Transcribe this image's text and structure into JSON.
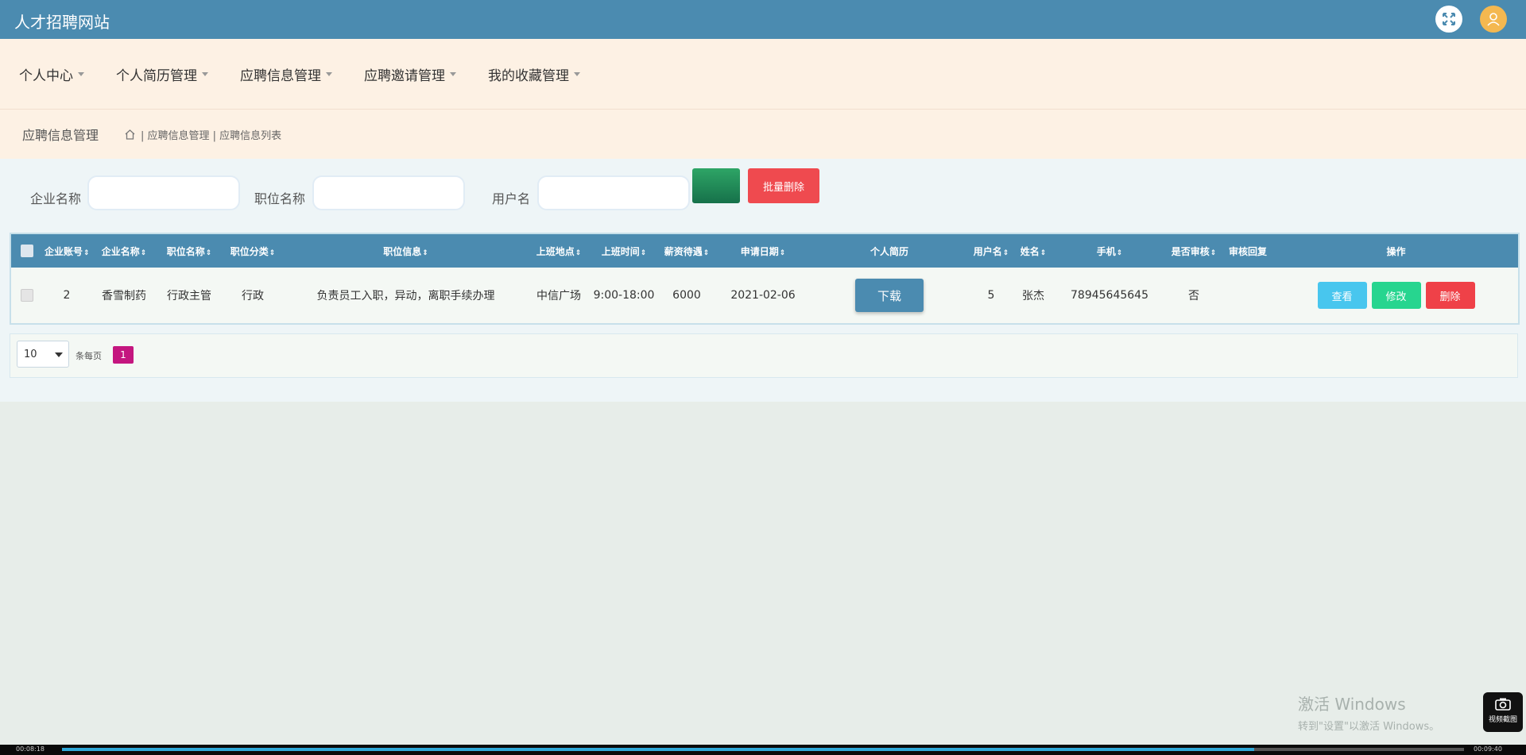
{
  "header": {
    "site_title": "人才招聘网站"
  },
  "nav": [
    {
      "label": "个人中心"
    },
    {
      "label": "个人简历管理"
    },
    {
      "label": "应聘信息管理"
    },
    {
      "label": "应聘邀请管理"
    },
    {
      "label": "我的收藏管理"
    }
  ],
  "breadcrumb": {
    "page_title": "应聘信息管理",
    "path": "| 应聘信息管理 | 应聘信息列表"
  },
  "search": {
    "company_label": "企业名称",
    "position_label": "职位名称",
    "username_label": "用户名",
    "search_button": "",
    "batch_delete_button": "批量删除"
  },
  "table": {
    "columns": [
      "企业账号",
      "企业名称",
      "职位名称",
      "职位分类",
      "职位信息",
      "上班地点",
      "上班时间",
      "薪资待遇",
      "申请日期",
      "个人简历",
      "用户名",
      "姓名",
      "手机",
      "是否审核",
      "审核回复",
      "操作"
    ],
    "rows": [
      {
        "company_account": "2",
        "company_name": "香雪制药",
        "position_name": "行政主管",
        "position_category": "行政",
        "position_info": "负责员工入职，异动，离职手续办理",
        "work_location": "中信广场",
        "work_hours": "9:00-18:00",
        "salary": "6000",
        "apply_date": "2021-02-06",
        "resume_button": "下载",
        "username": "5",
        "name": "张杰",
        "phone": "78945645645",
        "reviewed": "否",
        "review_reply": "",
        "view_button": "查看",
        "edit_button": "修改",
        "delete_button": "删除"
      }
    ]
  },
  "pagination": {
    "page_size": "10",
    "per_page_label": "条每页",
    "current_page": "1"
  },
  "watermark": {
    "title": "激活 Windows",
    "subtitle": "转到\"设置\"以激活 Windows。"
  },
  "video": {
    "current_time": "00:08:18",
    "total_time": "00:09:40",
    "screenshot_label": "视频截图"
  },
  "colors": {
    "header": "#4b8bb0",
    "nav_bg": "#fdf1e4",
    "danger": "#ef4a4f",
    "success": "#27d58f",
    "info": "#48c6ee",
    "page_active": "#c4167f"
  }
}
